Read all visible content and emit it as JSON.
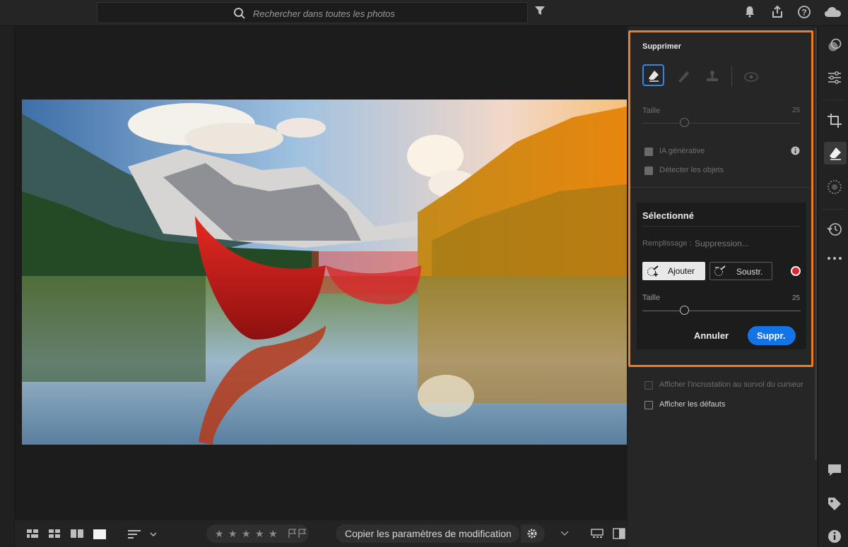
{
  "search": {
    "placeholder": "Rechercher dans toutes les photos"
  },
  "panel": {
    "title": "Supprimer",
    "size_label": "Taille",
    "size_value": "25",
    "generative_ai_label": "IA générative",
    "detect_objects_label": "Détecter les objets",
    "selected_title": "Sélectionné",
    "fill_label": "Remplissage :",
    "fill_value": "Suppression...",
    "add_label": "Ajouter",
    "subtract_label": "Soustr.",
    "brush_size_label": "Taille",
    "brush_size_value": "25",
    "cancel_label": "Annuler",
    "remove_label": "Suppr.",
    "show_overlay_label": "Afficher l'incrustation au survol du curseur",
    "show_defects_label": "Afficher les défauts"
  },
  "bottombar": {
    "copy_settings_label": "Copier les paramètres de modification",
    "rating_stars": 5
  },
  "colors": {
    "accent": "#1473e6",
    "highlight": "#f07b25",
    "mask_dot": "#e0262a"
  }
}
